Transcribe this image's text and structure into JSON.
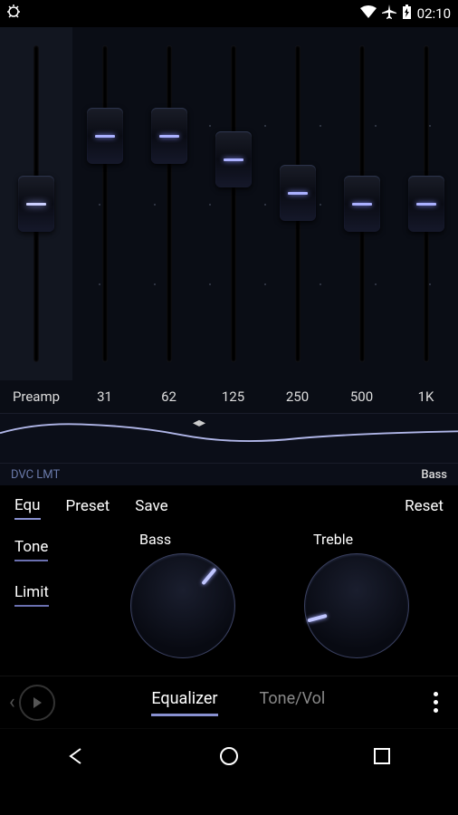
{
  "status": {
    "time": "02:10"
  },
  "eq": {
    "preamp_label": "Preamp",
    "preamp_pos": 0.5,
    "bands": [
      {
        "label": "31",
        "pos": 0.24
      },
      {
        "label": "62",
        "pos": 0.24
      },
      {
        "label": "125",
        "pos": 0.33
      },
      {
        "label": "250",
        "pos": 0.46
      },
      {
        "label": "500",
        "pos": 0.5
      },
      {
        "label": "1K",
        "pos": 0.5
      }
    ]
  },
  "info": {
    "left": "DVC LMT",
    "right": "Bass"
  },
  "controls": {
    "equ": "Equ",
    "preset": "Preset",
    "save": "Save",
    "reset": "Reset"
  },
  "toggles": {
    "tone": "Tone",
    "limit": "Limit"
  },
  "rotary": {
    "bass": {
      "label": "Bass",
      "angle": -50
    },
    "treble": {
      "label": "Treble",
      "angle": 165
    }
  },
  "tabs": {
    "equalizer": "Equalizer",
    "tonevol": "Tone/Vol"
  }
}
